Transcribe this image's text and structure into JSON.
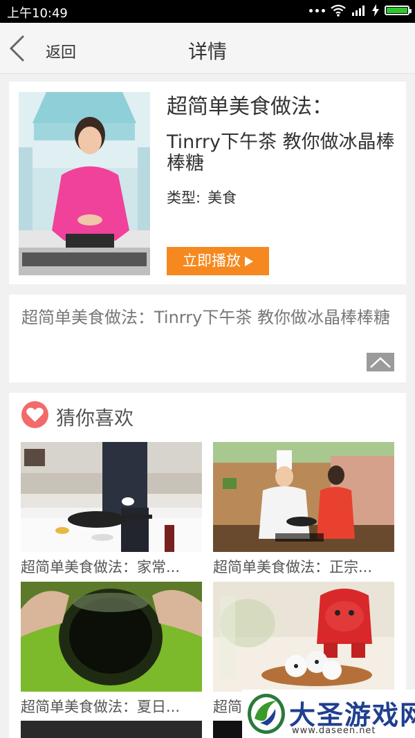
{
  "status_bar": {
    "time": "上午10:49",
    "icons": [
      "more-dots-icon",
      "wifi-icon",
      "signal-icon",
      "charging-icon",
      "battery-icon"
    ]
  },
  "header": {
    "back_label": "返回",
    "title": "详情"
  },
  "detail": {
    "title": "超简单美食做法：",
    "subtitle": "Tinrry下午茶 教你做冰晶棒棒糖",
    "type_label": "类型:",
    "type_value": "美食",
    "play_label": "立即播放"
  },
  "description": {
    "text": "超简单美食做法：Tinrry下午茶 教你做冰晶棒棒糖"
  },
  "recommend": {
    "title": "猜你喜欢",
    "items": [
      {
        "caption": "超简单美食做法：家常..."
      },
      {
        "caption": "超简单美食做法：正宗..."
      },
      {
        "caption": "超简单美食做法：夏日..."
      },
      {
        "caption": "超简"
      }
    ]
  },
  "watermark": {
    "brand": "大圣游戏网",
    "url": "www.daseen.net"
  },
  "colors": {
    "accent": "#f5891f",
    "heart": "#f26a6a",
    "background": "#f1f1f1",
    "watermark_text": "#1f3f8f"
  }
}
